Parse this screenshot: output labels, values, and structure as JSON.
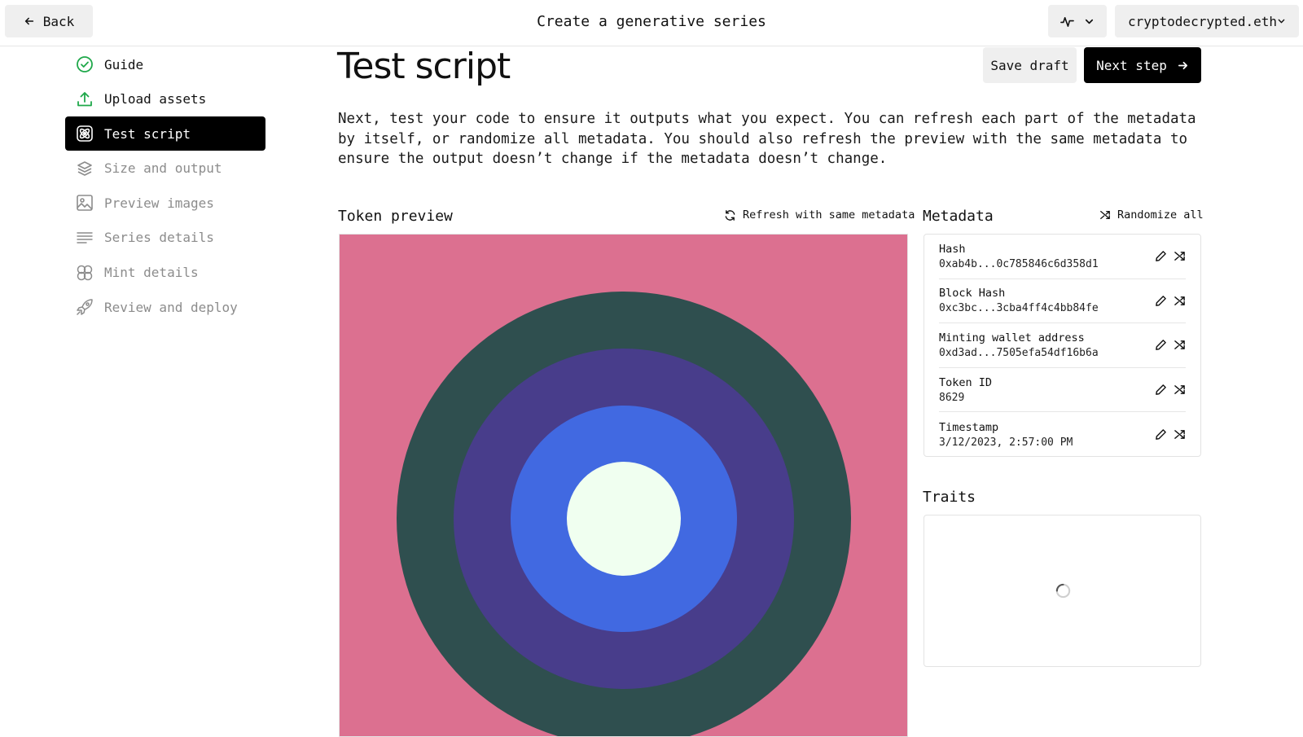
{
  "header": {
    "back_label": "Back",
    "title": "Create a generative series",
    "activity_icon": "activity-icon",
    "account": "cryptodecrypted.eth"
  },
  "sidebar": {
    "items": [
      {
        "label": "Guide",
        "icon": "check-circle-icon",
        "state": "done"
      },
      {
        "label": "Upload assets",
        "icon": "upload-icon",
        "state": "done"
      },
      {
        "label": "Test script",
        "icon": "atom-icon",
        "state": "active"
      },
      {
        "label": "Size and output",
        "icon": "layers-icon",
        "state": "pending"
      },
      {
        "label": "Preview images",
        "icon": "image-icon",
        "state": "pending"
      },
      {
        "label": "Series details",
        "icon": "text-lines-icon",
        "state": "pending"
      },
      {
        "label": "Mint details",
        "icon": "circles-icon",
        "state": "pending"
      },
      {
        "label": "Review and deploy",
        "icon": "rocket-icon",
        "state": "pending"
      }
    ]
  },
  "main": {
    "title": "Test script",
    "save_draft": "Save draft",
    "next_step": "Next step",
    "intro": "Next, test your code to ensure it outputs what you expect. You can refresh each part of the metadata by itself, or randomize all metadata. You should also refresh the preview with the same metadata to ensure the output doesn’t change if the metadata doesn’t change."
  },
  "preview": {
    "label": "Token preview",
    "refresh_label": "Refresh with same metadata",
    "colors": {
      "background": "#dc7090",
      "ring1": "#2f4f4f",
      "ring2": "#483d8b",
      "ring3": "#4169e1",
      "center": "#f0fff0"
    }
  },
  "metadata": {
    "label": "Metadata",
    "randomize_label": "Randomize all",
    "rows": [
      {
        "key": "Hash",
        "value": "0xab4b...0c785846c6d358d1"
      },
      {
        "key": "Block Hash",
        "value": "0xc3bc...3cba4ff4c4bb84fe"
      },
      {
        "key": "Minting wallet address",
        "value": "0xd3ad...7505efa54df16b6a"
      },
      {
        "key": "Token ID",
        "value": "8629"
      },
      {
        "key": "Timestamp",
        "value": "3/12/2023, 2:57:00 PM"
      }
    ]
  },
  "traits": {
    "label": "Traits",
    "state": "loading"
  }
}
